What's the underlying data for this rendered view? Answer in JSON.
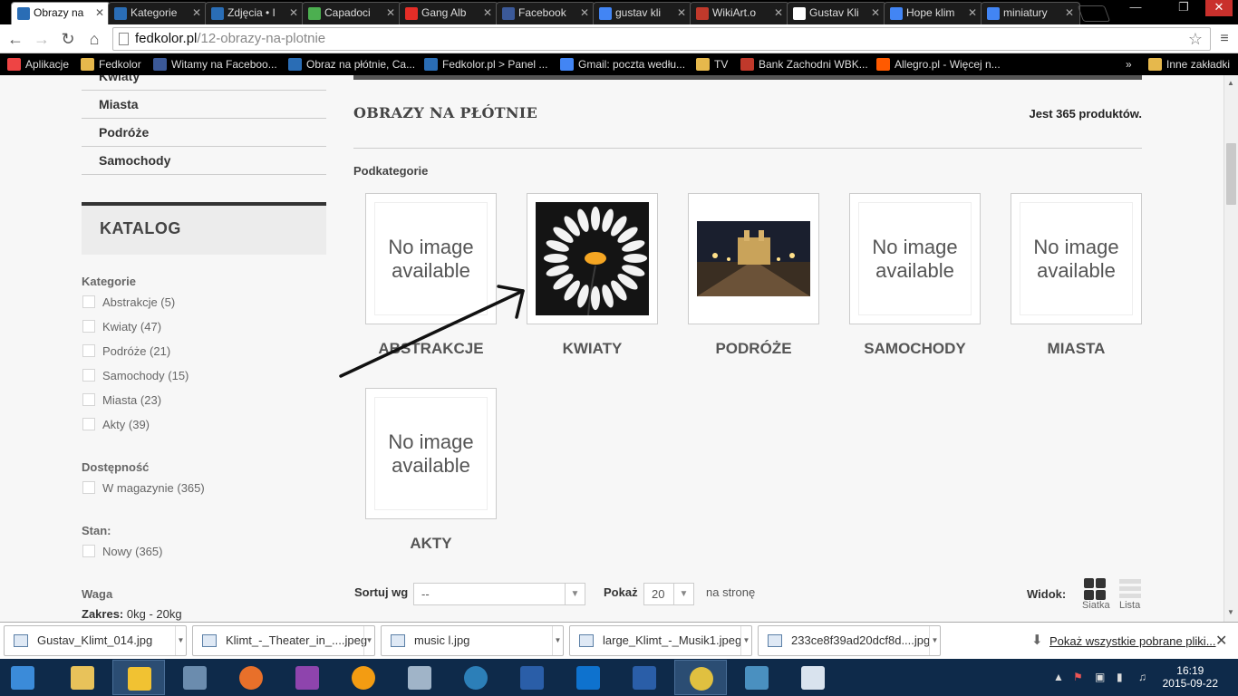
{
  "browser": {
    "tabs": [
      {
        "title": "Obrazy na",
        "favicon": "prestashop-icon",
        "color": "#2a6db5",
        "active": true
      },
      {
        "title": "Kategorie",
        "favicon": "prestashop-icon",
        "color": "#2a6db5"
      },
      {
        "title": "Zdjęcia • I",
        "favicon": "prestashop-icon",
        "color": "#2a6db5"
      },
      {
        "title": "Capadoci",
        "favicon": "pixabay-icon",
        "color": "#4caf50"
      },
      {
        "title": "Gang Alb",
        "favicon": "youtube-icon",
        "color": "#e52d27"
      },
      {
        "title": "Facebook",
        "favicon": "facebook-icon",
        "color": "#3b5998"
      },
      {
        "title": "gustav kli",
        "favicon": "google-icon",
        "color": "#4285f4"
      },
      {
        "title": "WikiArt.o",
        "favicon": "wikiart-icon",
        "color": "#c0392b"
      },
      {
        "title": "Gustav Kli",
        "favicon": "wikipedia-icon",
        "color": "#ffffff"
      },
      {
        "title": "Hope klim",
        "favicon": "google-icon",
        "color": "#4285f4"
      },
      {
        "title": "miniatury",
        "favicon": "google-icon",
        "color": "#4285f4"
      }
    ],
    "url_host": "fedkolor.pl",
    "url_path": "/12-obrazy-na-plotnie",
    "bookmarks": [
      {
        "label": "Aplikacje",
        "icon": "apps-icon",
        "color": "#e44"
      },
      {
        "label": "Fedkolor",
        "icon": "folder-icon",
        "color": "#e6b84c"
      },
      {
        "label": "Witamy na Faceboo...",
        "icon": "facebook-icon",
        "color": "#3b5998"
      },
      {
        "label": "Obraz na płótnie, Ca...",
        "icon": "prestashop-icon",
        "color": "#2a6db5"
      },
      {
        "label": "Fedkolor.pl > Panel ...",
        "icon": "prestashop-icon",
        "color": "#2a6db5"
      },
      {
        "label": "Gmail: poczta wedłu...",
        "icon": "google-icon",
        "color": "#4285f4"
      },
      {
        "label": "TV",
        "icon": "folder-icon",
        "color": "#e6b84c"
      },
      {
        "label": "Bank Zachodni WBK...",
        "icon": "bank-icon",
        "color": "#c0392b"
      },
      {
        "label": "Allegro.pl - Więcej n...",
        "icon": "allegro-icon",
        "color": "#ff5a00"
      }
    ],
    "bookmarks_more": "»",
    "other_bookmarks": "Inne zakładki"
  },
  "sidebar": {
    "top_links": [
      "Kwiaty",
      "Miasta",
      "Podróże",
      "Samochody"
    ],
    "catalog_title": "KATALOG",
    "filters": {
      "categories_title": "Kategorie",
      "categories": [
        "Abstrakcje (5)",
        "Kwiaty (47)",
        "Podróże (21)",
        "Samochody (15)",
        "Miasta (23)",
        "Akty (39)"
      ],
      "availability_title": "Dostępność",
      "availability": [
        "W magazynie (365)"
      ],
      "condition_title": "Stan:",
      "condition": [
        "Nowy (365)"
      ],
      "weight_title": "Waga",
      "range_label": "Zakres:",
      "range_value": "0kg - 20kg"
    }
  },
  "main": {
    "title": "OBRAZY NA PŁÓTNIE",
    "count": "Jest 365 produktów.",
    "subcategories_title": "Podkategorie",
    "no_image_text": "No image available",
    "subcategories": [
      {
        "label": "ABSTRAKCJE",
        "image": "none"
      },
      {
        "label": "KWIATY",
        "image": "daisy"
      },
      {
        "label": "PODRÓŻE",
        "image": "castle-night"
      },
      {
        "label": "SAMOCHODY",
        "image": "none"
      },
      {
        "label": "MIASTA",
        "image": "none"
      },
      {
        "label": "AKTY",
        "image": "none"
      }
    ],
    "sort_label": "Sortuj wg",
    "sort_value": "--",
    "show_label": "Pokaż",
    "show_value": "20",
    "per_page_label": "na stronę",
    "view_label": "Widok:",
    "view_grid": "Siatka",
    "view_list": "Lista"
  },
  "downloads": {
    "items": [
      "Gustav_Klimt_014.jpg",
      "Klimt_-_Theater_in_....jpeg",
      "music l.jpg",
      "large_Klimt_-_Musik1.jpeg",
      "233ce8f39ad20dcf8d....jpg"
    ],
    "show_all": "Pokaż wszystkie pobrane pliki..."
  },
  "taskbar": {
    "apps": [
      {
        "name": "windows-start-icon",
        "color": "#3b8bd9"
      },
      {
        "name": "file-explorer-icon",
        "color": "#e8c25a"
      },
      {
        "name": "outlook-icon",
        "color": "#f1c232"
      },
      {
        "name": "network-icon",
        "color": "#6b8cae"
      },
      {
        "name": "firefox-icon",
        "color": "#e8702a"
      },
      {
        "name": "winrar-icon",
        "color": "#8e44ad"
      },
      {
        "name": "ball-app-icon",
        "color": "#f39c12"
      },
      {
        "name": "calculator-icon",
        "color": "#a0b4c8"
      },
      {
        "name": "speedtest-icon",
        "color": "#2c7fb8"
      },
      {
        "name": "photoshop-icon",
        "color": "#2a5ea8"
      },
      {
        "name": "teamviewer-icon",
        "color": "#0e72ce"
      },
      {
        "name": "photoshop-icon",
        "color": "#2a5ea8"
      },
      {
        "name": "chrome-icon",
        "color": "#e0c040"
      },
      {
        "name": "photo-viewer-icon",
        "color": "#4a90c0"
      },
      {
        "name": "paint-icon",
        "color": "#d9e3ee"
      }
    ],
    "time": "16:19",
    "date": "2015-09-22"
  }
}
